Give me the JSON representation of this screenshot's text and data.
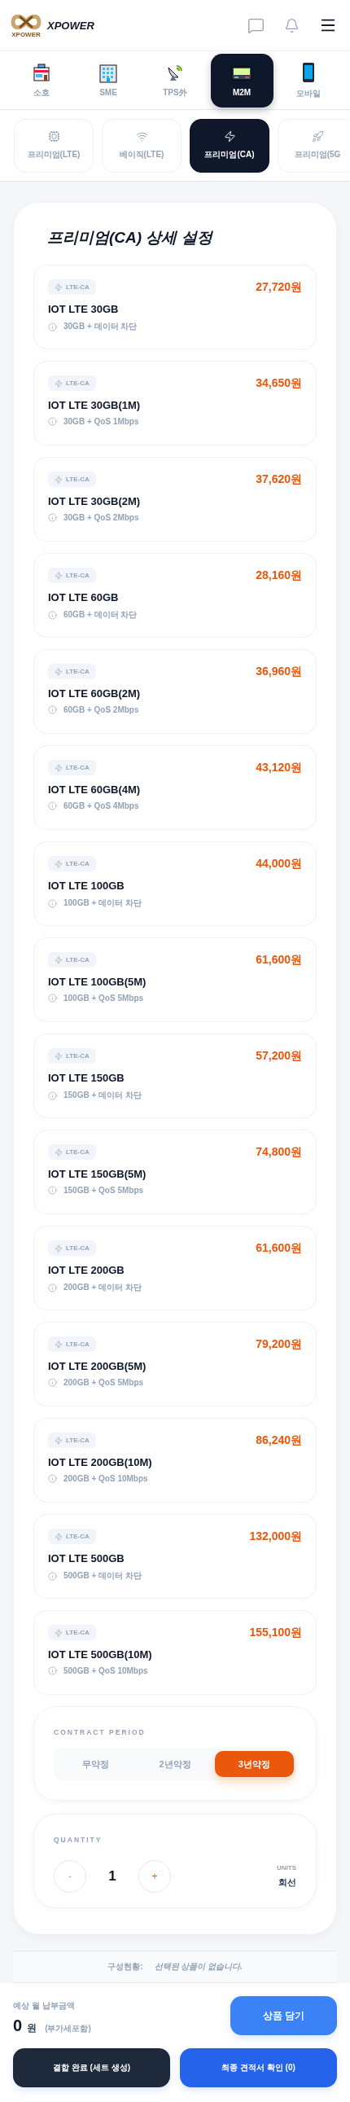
{
  "header": {
    "logo_caption": "XPOWER",
    "brand": "XPOWER"
  },
  "categories": [
    {
      "label": "소호",
      "kind": "store",
      "selected": false
    },
    {
      "label": "SME",
      "kind": "building",
      "selected": false
    },
    {
      "label": "TPS外",
      "kind": "satellite",
      "selected": false
    },
    {
      "label": "M2M",
      "kind": "pager",
      "selected": true
    },
    {
      "label": "모바일",
      "kind": "phone",
      "selected": false
    }
  ],
  "subtabs": [
    {
      "label": "프리미엄(LTE)",
      "kind": "chip",
      "selected": false
    },
    {
      "label": "베이직(LTE)",
      "kind": "wifi",
      "selected": false
    },
    {
      "label": "프리미엄(CA)",
      "kind": "bolt",
      "selected": true
    },
    {
      "label": "프리미엄(5G",
      "kind": "rocket",
      "selected": false
    }
  ],
  "panel": {
    "title": "프리미엄(CA) 상세 설정",
    "plans": [
      {
        "badge": "LTE-CA",
        "name": "IOT LTE 30GB",
        "price": "27,720원",
        "detail": "30GB + 데이터 차단"
      },
      {
        "badge": "LTE-CA",
        "name": "IOT LTE 30GB(1M)",
        "price": "34,650원",
        "detail": "30GB + QoS 1Mbps"
      },
      {
        "badge": "LTE-CA",
        "name": "IOT LTE 30GB(2M)",
        "price": "37,620원",
        "detail": "30GB + QoS 2Mbps"
      },
      {
        "badge": "LTE-CA",
        "name": "IOT LTE 60GB",
        "price": "28,160원",
        "detail": "60GB + 데이터 차단"
      },
      {
        "badge": "LTE-CA",
        "name": "IOT LTE 60GB(2M)",
        "price": "36,960원",
        "detail": "60GB + QoS 2Mbps"
      },
      {
        "badge": "LTE-CA",
        "name": "IOT LTE 60GB(4M)",
        "price": "43,120원",
        "detail": "60GB + QoS 4Mbps"
      },
      {
        "badge": "LTE-CA",
        "name": "IOT LTE 100GB",
        "price": "44,000원",
        "detail": "100GB + 데이터 차단"
      },
      {
        "badge": "LTE-CA",
        "name": "IOT LTE 100GB(5M)",
        "price": "61,600원",
        "detail": "100GB + QoS 5Mbps"
      },
      {
        "badge": "LTE-CA",
        "name": "IOT LTE 150GB",
        "price": "57,200원",
        "detail": "150GB + 데이터 차단"
      },
      {
        "badge": "LTE-CA",
        "name": "IOT LTE 150GB(5M)",
        "price": "74,800원",
        "detail": "150GB + QoS 5Mbps"
      },
      {
        "badge": "LTE-CA",
        "name": "IOT LTE 200GB",
        "price": "61,600원",
        "detail": "200GB + 데이터 차단"
      },
      {
        "badge": "LTE-CA",
        "name": "IOT LTE 200GB(5M)",
        "price": "79,200원",
        "detail": "200GB + QoS 5Mbps"
      },
      {
        "badge": "LTE-CA",
        "name": "IOT LTE 200GB(10M)",
        "price": "86,240원",
        "detail": "200GB + QoS 10Mbps"
      },
      {
        "badge": "LTE-CA",
        "name": "IOT LTE 500GB",
        "price": "132,000원",
        "detail": "500GB + 데이터 차단"
      },
      {
        "badge": "LTE-CA",
        "name": "IOT LTE 500GB(10M)",
        "price": "155,100원",
        "detail": "500GB + QoS 10Mbps"
      }
    ],
    "contract": {
      "label": "CONTRACT PERIOD",
      "options": [
        {
          "label": "무약정",
          "selected": false
        },
        {
          "label": "2년약정",
          "selected": false
        },
        {
          "label": "3년약정",
          "selected": true
        }
      ]
    },
    "quantity": {
      "label": "QUANTITY",
      "minus": "-",
      "value": "1",
      "plus": "+",
      "units_label": "UNITS",
      "units": "회선"
    }
  },
  "status": {
    "label": "구성현황:",
    "value": "선택된 상품이 없습니다."
  },
  "footer": {
    "total_label": "예상 월 납부금액",
    "amount": "0",
    "currency": "원",
    "vat_note": "(부가세포함)",
    "add_button": "상품 담기",
    "combine_button": "결합 완료 (세트 생성)",
    "quote_button": "최종 견적서 확인 (0)"
  }
}
